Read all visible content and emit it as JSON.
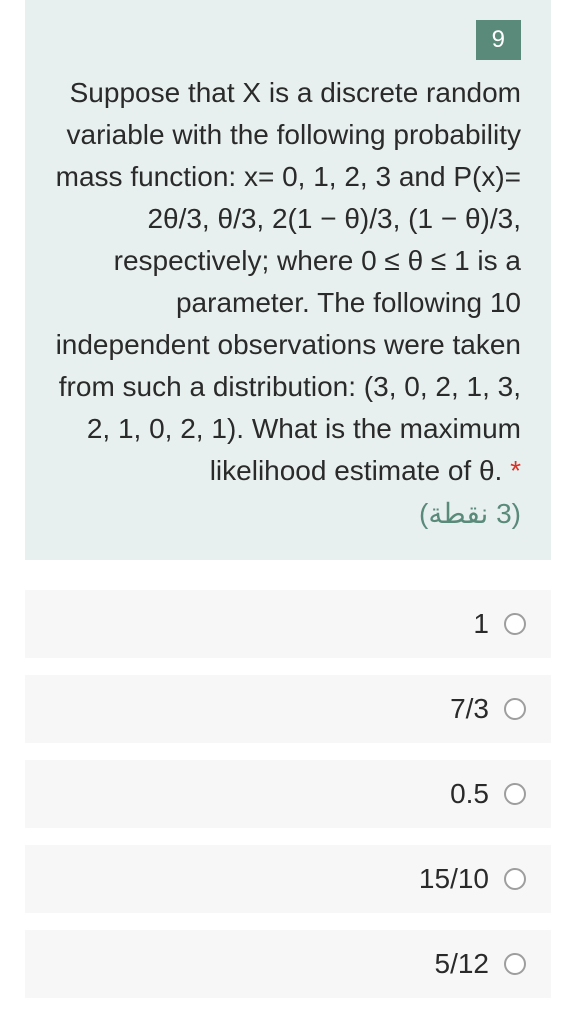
{
  "question": {
    "number": "9",
    "text": "Suppose that X is a discrete random variable with the following probability mass function: x= 0, 1, 2, 3 and P(x)= 2θ/3, θ/3, 2(1 − θ)/3, (1 − θ)/3, respectively; where 0 ≤ θ ≤ 1 is a parameter. The following 10 independent observations were taken from such a distribution: (3, 0, 2, 1, 3, 2, 1, 0, 2, 1). What is the maximum likelihood estimate of θ.",
    "required_mark": "*",
    "points": "(3 نقطة)"
  },
  "options": [
    "1",
    "7/3",
    "0.5",
    "15/10",
    "5/12"
  ]
}
